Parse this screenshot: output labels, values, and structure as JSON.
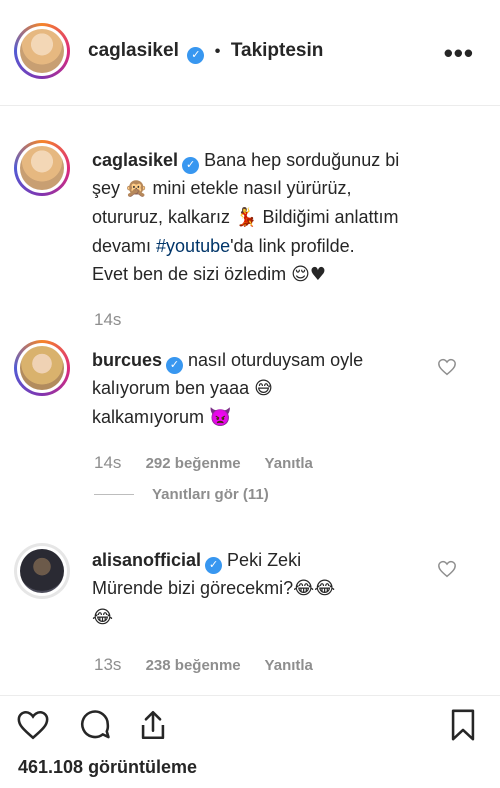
{
  "header": {
    "username": "caglasikel",
    "dot": "•",
    "following_label": "Takiptesin",
    "more_label": "•••"
  },
  "caption": {
    "username": "caglasikel",
    "text_1": " Bana hep sorduğunuz bi",
    "text_2": "şey ",
    "emoji_monkey": "🙊",
    "text_3": " mini etekle nasıl yürürüz,",
    "text_4": "otururuz, kalkarız ",
    "emoji_dancer": "💃",
    "text_5": " Bildiğimi anlattım",
    "text_6": "devamı ",
    "hashtag": "#youtube",
    "text_7": "'da link profilde.",
    "text_8": "Evet ben de sizi özledim ",
    "emoji_end": "😌♥",
    "time": "14s"
  },
  "comments": [
    {
      "username": "burcues",
      "line1": " nasıl oturduysam oyle",
      "line2": "kalıyorum ben yaaa ",
      "emoji_a": "😅",
      "line3": "kalkamıyorum ",
      "emoji_b": "👿",
      "time": "14s",
      "likes": "292 beğenme",
      "reply_label": "Yanıtla",
      "view_replies": "Yanıtları gör (11)"
    },
    {
      "username": "alisanofficial",
      "line1": " Peki Zeki",
      "line2": "Mürende bizi görecekmi?",
      "emoji_a": "😂😂",
      "emoji_b": "😂",
      "time": "13s",
      "likes": "238 beğenme",
      "reply_label": "Yanıtla"
    }
  ],
  "footer": {
    "views": "461.108 görüntüleme"
  },
  "icons": {
    "verified": "verified-badge-icon",
    "like": "heart-icon",
    "comment": "comment-bubble-icon",
    "share": "share-icon",
    "save": "bookmark-icon"
  },
  "colors": {
    "verified": "#3897f0",
    "hashtag": "#003569",
    "meta": "#8e8e8e"
  }
}
